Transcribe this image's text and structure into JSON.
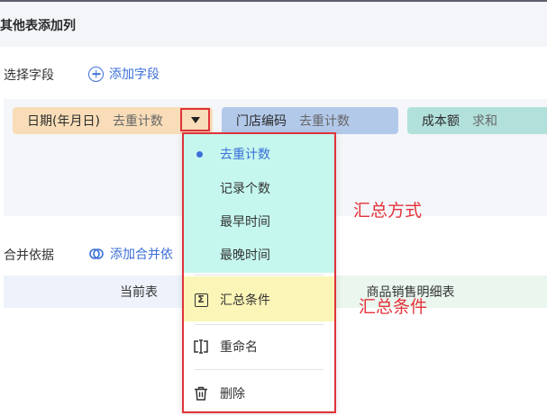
{
  "header": {
    "title": "其他表添加列"
  },
  "fields_section": {
    "label": "选择字段",
    "add_label": "添加字段",
    "chips": [
      {
        "name": "日期(年月日)",
        "agg": "去重计数"
      },
      {
        "name": "门店编码",
        "agg": "去重计数"
      },
      {
        "name": "成本额",
        "agg": "求和"
      }
    ]
  },
  "merge_section": {
    "label": "合并依据",
    "add_label": "添加合并依"
  },
  "table": {
    "left_header": "当前表",
    "right_header": "商品销售明细表"
  },
  "menu": {
    "agg_options": [
      "去重计数",
      "记录个数",
      "最早时间",
      "最晚时间"
    ],
    "selected_index": 0,
    "summary_condition": "汇总条件",
    "rename": "重命名",
    "delete": "删除"
  },
  "annotations": {
    "method": "汇总方式",
    "condition": "汇总条件"
  },
  "colors": {
    "accent": "#3b6fd8",
    "highlight_red": "#e0323a",
    "chip_date": "#f8ddb8",
    "chip_store": "#b3c9ea",
    "chip_cost": "#b2e1dc",
    "menu_top_bg": "#c5f7ee",
    "menu_cond_bg": "#fbf5b7"
  }
}
